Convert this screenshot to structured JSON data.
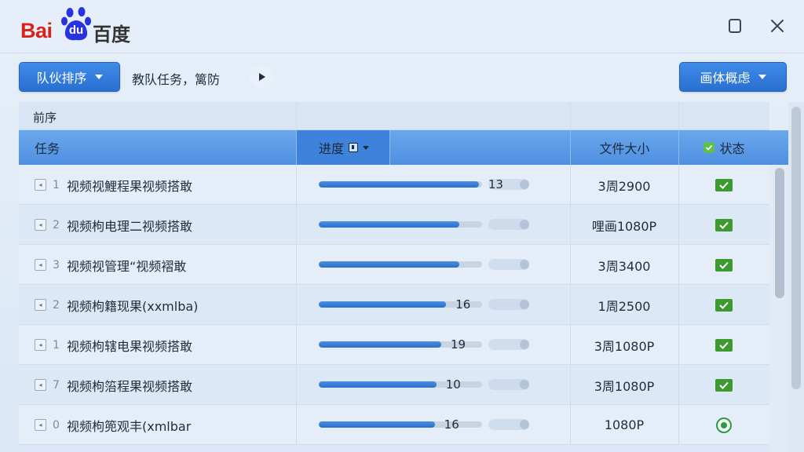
{
  "app": {
    "logo_bai": "Bai",
    "logo_du": "du",
    "logo_cn": "百度"
  },
  "toolbar": {
    "sort_button_label": "队伙排序",
    "info_text": "教队任务，篱防",
    "right_button_label": "画体概虑"
  },
  "table": {
    "group_label": "前序",
    "headers": {
      "task": "任务",
      "progress": "进度",
      "size": "文件大小",
      "status": "状态"
    },
    "rows": [
      {
        "num": "1",
        "name": "视频视鯉程果视频搭敢",
        "progress": 0.98,
        "label": "13",
        "size": "3周2900",
        "status": "check"
      },
      {
        "num": "2",
        "name": "视频枸电理二视频搭敢",
        "progress": 0.86,
        "label": "",
        "size": "哩画1080P",
        "status": "check"
      },
      {
        "num": "3",
        "name": "视频视管理“视频褶敢",
        "progress": 0.86,
        "label": "",
        "size": "3周3400",
        "status": "check"
      },
      {
        "num": "2",
        "name": "视频枸籍现果(xxmlba)",
        "progress": 0.78,
        "label": "16",
        "size": "1周2500",
        "status": "check"
      },
      {
        "num": "1",
        "name": "视频枸辖电果视频搭敢",
        "progress": 0.75,
        "label": "19",
        "size": "3周1080P",
        "status": "check"
      },
      {
        "num": "7",
        "name": "视频枸箈程果视频搭敢",
        "progress": 0.72,
        "label": "10",
        "size": "3周1080P",
        "status": "check"
      },
      {
        "num": "0",
        "name": "视频枸篼观丰(xmlbar",
        "progress": 0.71,
        "label": "16",
        "size": "1080P",
        "status": "radio"
      }
    ]
  },
  "colors": {
    "accent": "#2a6fd0",
    "header": "#5a9ae6",
    "check": "#3c9a2e",
    "logo_red": "#d9231a",
    "logo_blue": "#2932e1"
  }
}
